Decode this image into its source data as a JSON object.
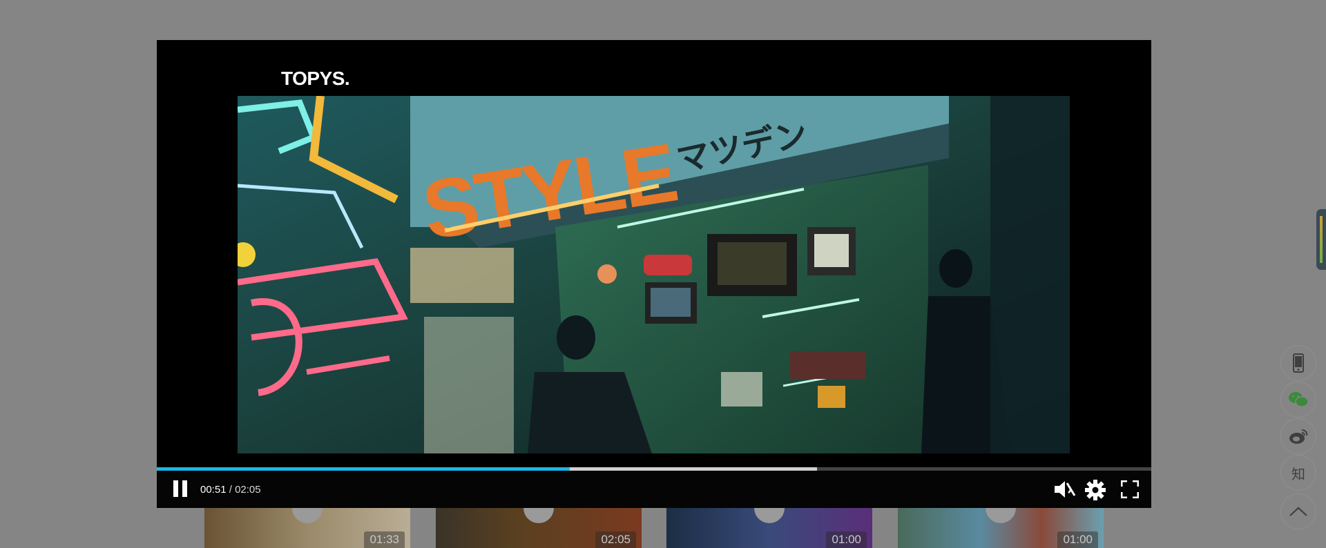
{
  "thumbnails": [
    {
      "duration": "01:33"
    },
    {
      "duration": "02:05"
    },
    {
      "duration": "01:00"
    },
    {
      "duration": "01:00"
    }
  ],
  "player": {
    "brand": "TOPYS.",
    "current_time": "00:51",
    "separator": " / ",
    "total_time": "02:05",
    "played_fraction": 0.415,
    "buffered_fraction": 0.664,
    "accent_color": "#1fb5e6"
  },
  "sidebar": {
    "items": [
      {
        "icon": "mobile-icon"
      },
      {
        "icon": "wechat-icon"
      },
      {
        "icon": "weibo-icon"
      },
      {
        "icon": "zhihu-icon",
        "label": "知"
      },
      {
        "icon": "back-to-top-icon"
      }
    ]
  }
}
